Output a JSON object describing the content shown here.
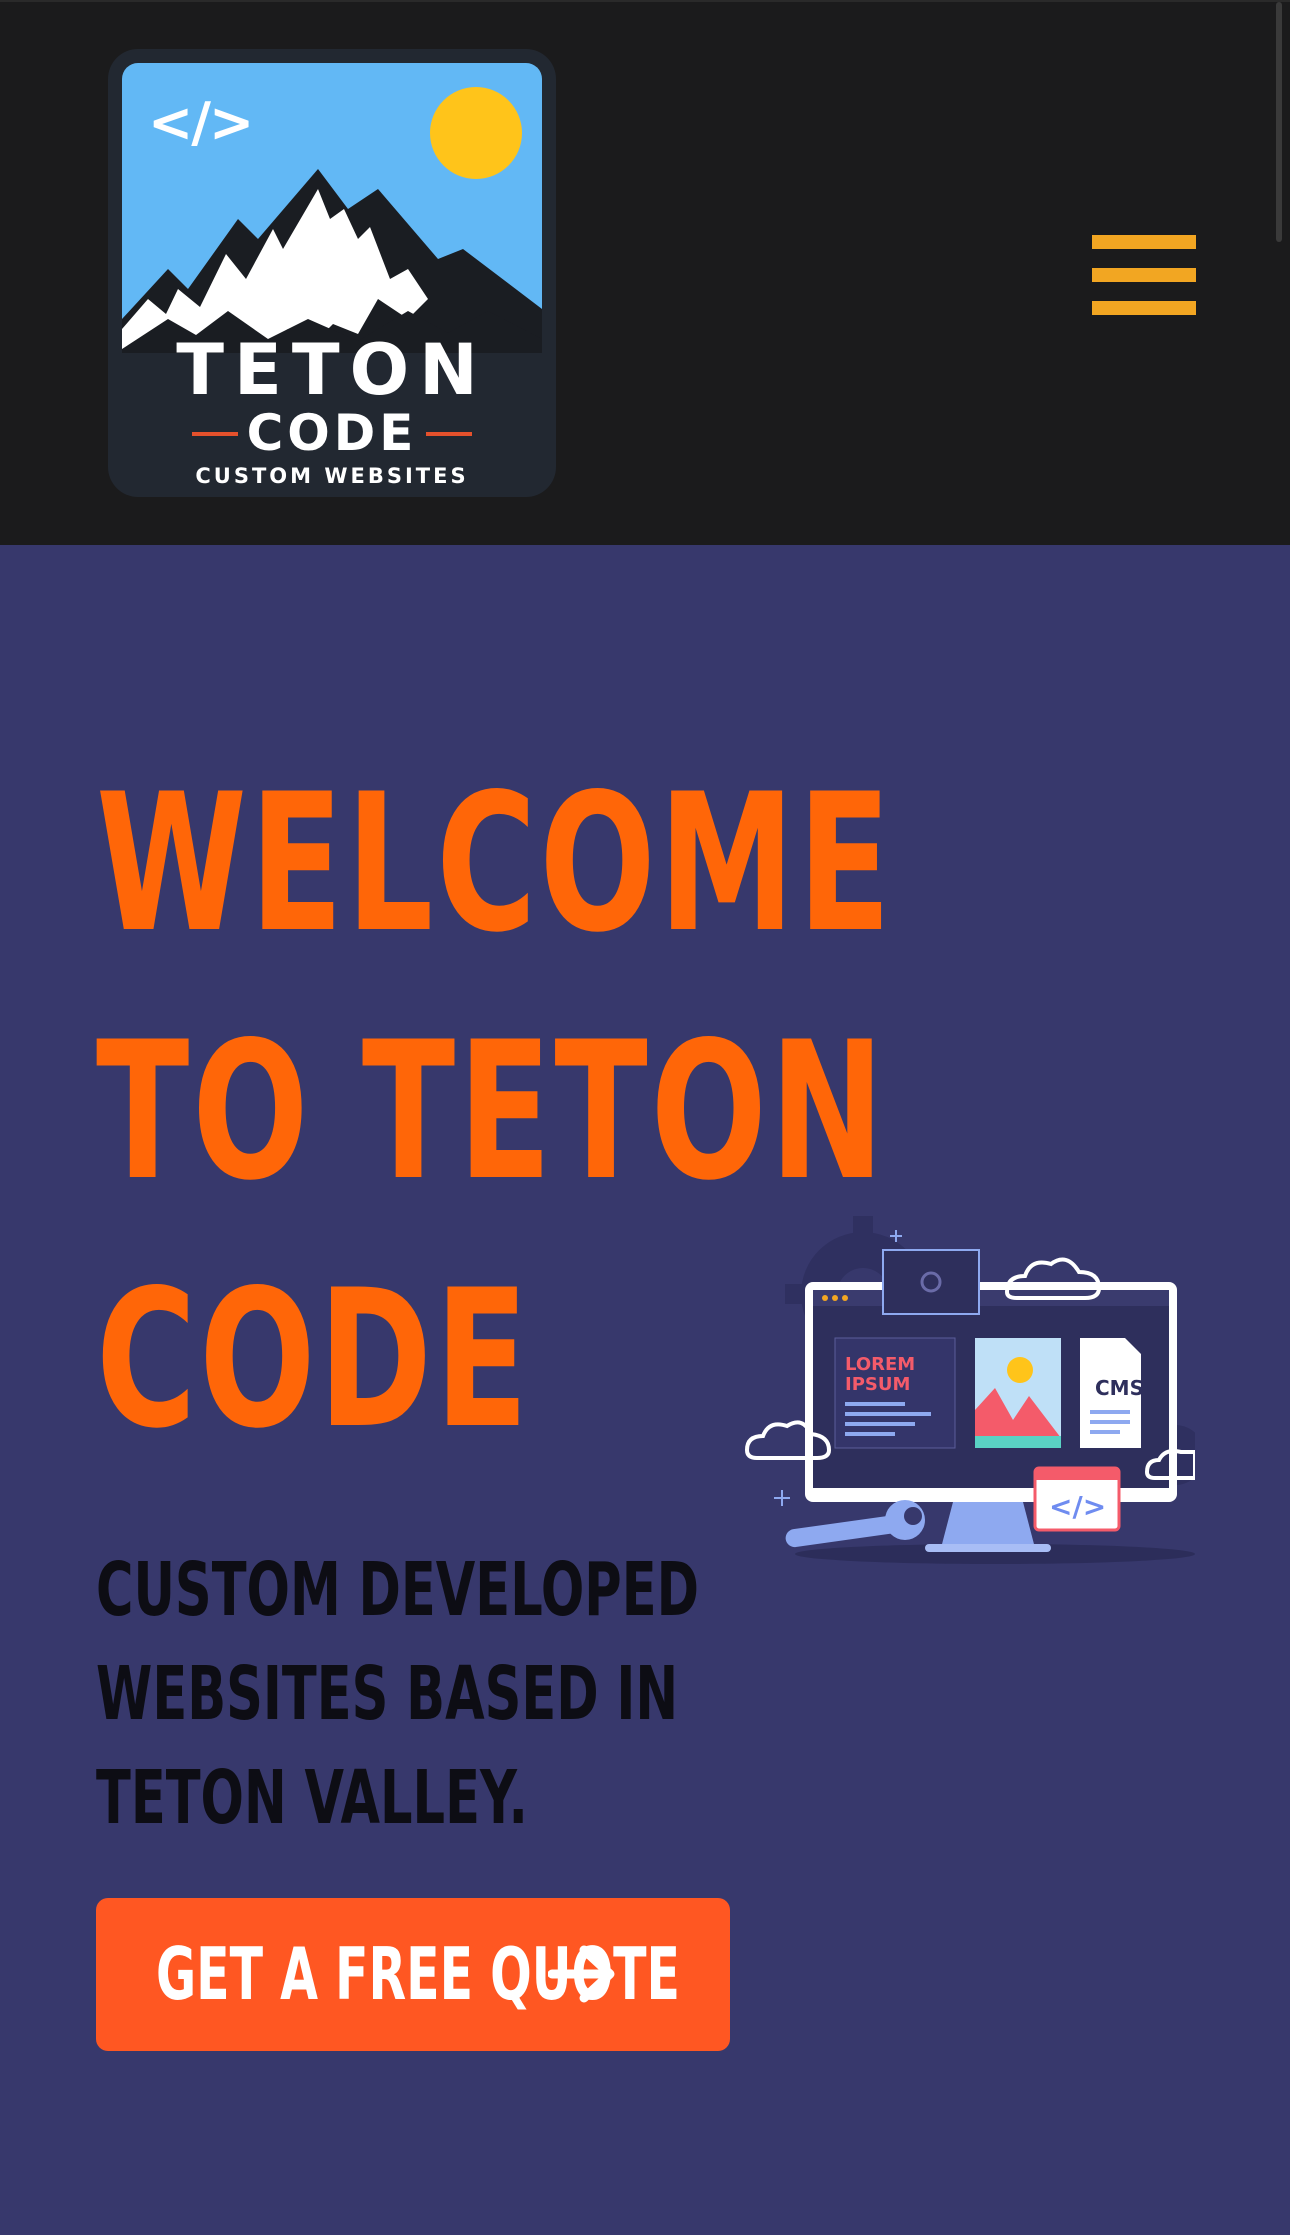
{
  "header": {
    "logo": {
      "code_symbol": "</>",
      "title": "TETON",
      "subtitle": "CODE",
      "tagline": "CUSTOM WEBSITES"
    },
    "menu_icon": "hamburger-menu-icon",
    "menu_color": "#f2a622"
  },
  "hero": {
    "title_lines": [
      "WELCOME",
      "TO TETON",
      "CODE"
    ],
    "subtitle": "Custom developed websites based in Teton Valley.",
    "cta_label": "GET A FREE QUOTE",
    "cta_icon": "arrow-right-icon",
    "illustration": {
      "content_title": "LOREM IPSUM",
      "cms_label": "CMS",
      "code_badge": "</>"
    }
  },
  "colors": {
    "header_bg": "#1b1b1c",
    "hero_bg": "#37386c",
    "accent_orange": "#ff6608",
    "button_bg": "#ff5722"
  }
}
